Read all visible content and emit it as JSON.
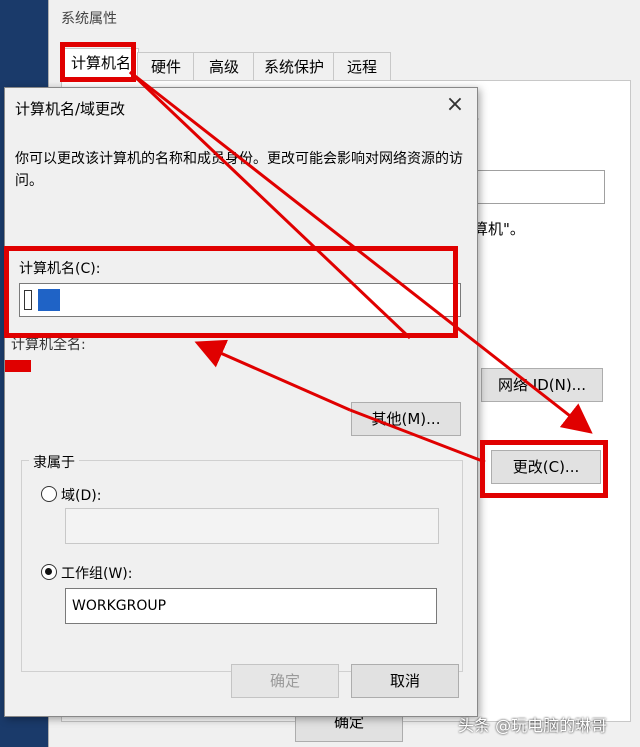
{
  "sysprops": {
    "title": "系统属性",
    "tabs": [
      "计算机名",
      "硬件",
      "高级",
      "系统保护",
      "远程"
    ],
    "text1": "。",
    "text2": "算机\"。",
    "network_id_button": "网络 ID(N)...",
    "change_button": "更改(C)...",
    "bottom_button": "确定"
  },
  "dialog": {
    "title": "计算机名/域更改",
    "close_icon": "×",
    "description": "你可以更改该计算机的名称和成员身份。更改可能会影响对网络资源的访问。",
    "computer_name_label": "计算机名(C):",
    "full_name_label": "计算机全名:",
    "other_button": "其他(M)...",
    "member_of_label": "隶属于",
    "domain_label": "域(D):",
    "workgroup_label": "工作组(W):",
    "workgroup_value": "WORKGROUP",
    "ok_button": "确定",
    "cancel_button": "取消"
  },
  "watermark": "头条 @玩电脑的琳哥",
  "colors": {
    "annotation": "#e00000",
    "selection": "#1f63c6"
  }
}
